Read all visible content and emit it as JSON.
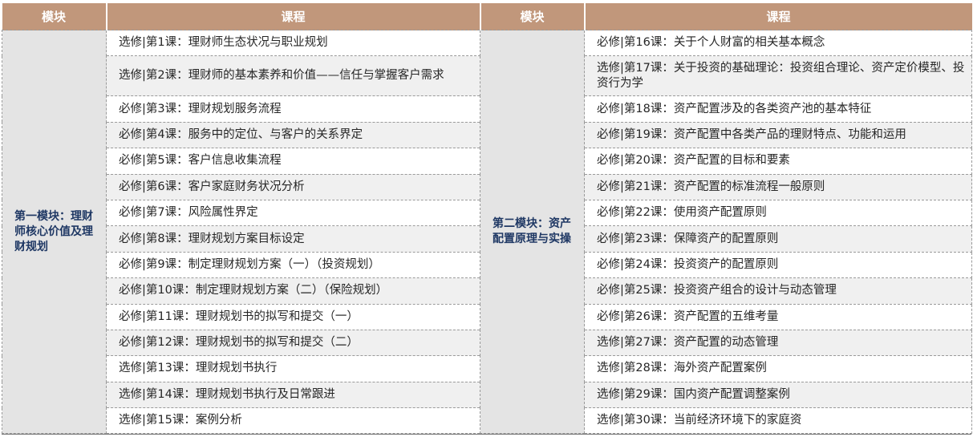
{
  "headers": [
    "模块",
    "课程",
    "模块",
    "课程"
  ],
  "modules": [
    {
      "title": "第一模块：理财师核心价值及理财规划",
      "courses": [
        "选修|第1课：理财师生态状况与职业规划",
        "选修|第2课：理财师的基本素养和价值——信任与掌握客户需求",
        "必修|第3课：理财规划服务流程",
        "必修|第4课：服务中的定位、与客户的关系界定",
        "必修|第5课：客户信息收集流程",
        "必修|第6课：客户家庭财务状况分析",
        "必修|第7课：风险属性界定",
        "必修|第8课：理财规划方案目标设定",
        "必修|第9课：制定理财规划方案（一）（投资规划）",
        "必修|第10课：制定理财规划方案（二）（保险规划）",
        "必修|第11课：理财规划书的拟写和提交（一）",
        "必修|第12课：理财规划书的拟写和提交（二）",
        "选修|第13课：理财规划书执行",
        "选修|第14课：理财规划书执行及日常跟进",
        "选修|第15课：案例分析"
      ]
    },
    {
      "title": "第二模块：资产配置原理与实操",
      "courses": [
        "必修|第16课：关于个人财富的相关基本概念",
        "选修|第17课：关于投资的基础理论：投资组合理论、资产定价模型、投资行为学",
        "必修|第18课：资产配置涉及的各类资产池的基本特征",
        "必修|第19课：资产配置中各类产品的理财特点、功能和运用",
        "必修|第20课：资产配置的目标和要素",
        "必修|第21课：资产配置的标准流程一般原则",
        "必修|第22课：使用资产配置原则",
        "必修|第23课：保障资产的配置原则",
        "必修|第24课：投资资产的配置原则",
        "必修|第25课：投资资产组合的设计与动态管理",
        "必修|第26课：资产配置的五维考量",
        "选修|第27课：资产配置的动态管理",
        "选修|第28课：海外资产配置案例",
        "选修|第29课：国内资产配置调整案例",
        "选修|第30课：当前经济环境下的家庭资"
      ]
    }
  ],
  "colors": {
    "header_bg": "#c1977b",
    "module_bg": "#e4e4e4",
    "module_text": "#1f3864",
    "alt_row_bg": "#f0f0f0"
  }
}
